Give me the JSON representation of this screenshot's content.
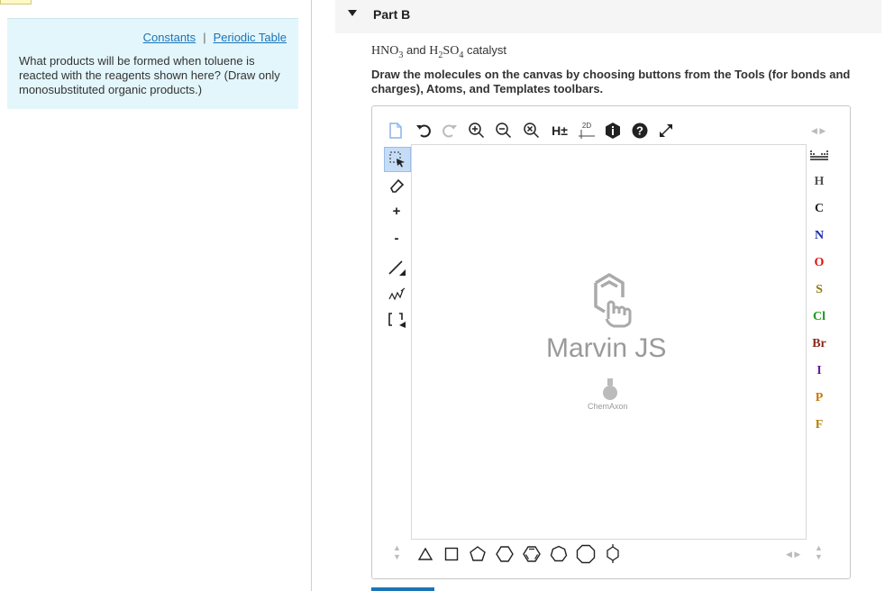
{
  "left": {
    "links": [
      "Constants",
      "Periodic Table"
    ],
    "separator": "|",
    "question": "What products will be formed when toluene is reacted with the reagents shown here? (Draw only monosubstituted organic products.)"
  },
  "part": {
    "title": "Part B"
  },
  "reagents": {
    "r1_base": "HNO",
    "r1_sub": "3",
    "and": "and",
    "r2_a": "H",
    "r2_sub1": "2",
    "r2_b": "SO",
    "r2_sub2": "4",
    "suffix": "catalyst"
  },
  "instructions": "Draw the molecules on the canvas by choosing buttons from the Tools (for bonds and charges), Atoms, and Templates toolbars.",
  "toolbar": {
    "h_toggle": "H±",
    "label_2d": "2D"
  },
  "left_tools": {
    "plus": "+",
    "minus": "-"
  },
  "atoms": [
    {
      "symbol": "H",
      "color": "#555555"
    },
    {
      "symbol": "C",
      "color": "#222222"
    },
    {
      "symbol": "N",
      "color": "#1a2aa8"
    },
    {
      "symbol": "O",
      "color": "#e0120f"
    },
    {
      "symbol": "S",
      "color": "#8a7a16"
    },
    {
      "symbol": "Cl",
      "color": "#1a9a1a"
    },
    {
      "symbol": "Br",
      "color": "#8a2a1a"
    },
    {
      "symbol": "I",
      "color": "#6a1a9a"
    },
    {
      "symbol": "P",
      "color": "#c8780a"
    },
    {
      "symbol": "F",
      "color": "#b5820a"
    }
  ],
  "logo": {
    "name": "Marvin JS",
    "vendor": "ChemAxon"
  }
}
